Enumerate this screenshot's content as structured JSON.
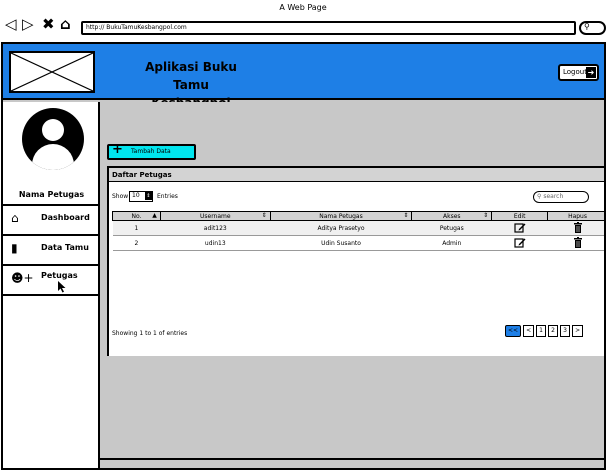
{
  "browser": {
    "window_title": "A Web Page",
    "address": "http:// BukuTamuKesbangpol.com"
  },
  "header": {
    "title_line1": "Aplikasi Buku Tamu",
    "title_line2": "Kesbangpol",
    "logout_label": "Logout"
  },
  "sidebar": {
    "user_name": "Nama Petugas",
    "items": [
      {
        "label": "Dashboard",
        "icon": "home-icon"
      },
      {
        "label": "Data Tamu",
        "icon": "book-icon"
      },
      {
        "label": "Petugas",
        "icon": "add-user-icon"
      }
    ]
  },
  "content": {
    "add_button_label": "Tambah Data",
    "panel_title": "Daftar Petugas",
    "show_label": "Show",
    "show_value": "10",
    "entries_label": "Entries",
    "search_placeholder": "search",
    "columns": [
      "No.",
      "Username",
      "Nama Petugas",
      "Akses",
      "Edit",
      "Hapus"
    ],
    "rows": [
      {
        "no": "1",
        "username": "adit123",
        "nama": "Aditya Prasetyo",
        "akses": "Petugas"
      },
      {
        "no": "2",
        "username": "udin13",
        "nama": "Udin Susanto",
        "akses": "Admin"
      }
    ],
    "showing_text": "Showing 1 to 1 of entries",
    "pagination": [
      "<<",
      "<",
      "1",
      "2",
      "3",
      ">"
    ]
  },
  "colors": {
    "header_blue": "#1e7fe6",
    "button_cyan": "#00e5ef",
    "background_gray": "#c8c8c8"
  }
}
